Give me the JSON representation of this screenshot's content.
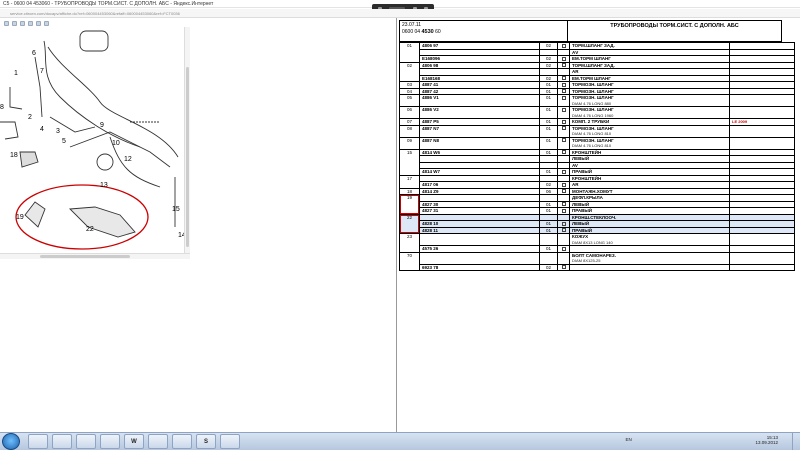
{
  "window": {
    "title": "C5 - 0600 04 453060 - ТРУБОПРОВОДЫ ТОРМ.СИСТ. С ДОПОЛН. АБС - Яндекс.Интернет",
    "url": "service.citroen.com/docapv/affiche.do?ref=060004453060&refaff=060004453060&ref=FCT0036"
  },
  "diagram": {
    "callouts": [
      "6",
      "7",
      "1",
      "8",
      "2",
      "4",
      "3",
      "5",
      "9",
      "10",
      "18",
      "12",
      "13",
      "15",
      "19",
      "22",
      "14"
    ]
  },
  "header": {
    "date": "23.07.11",
    "part_prefix": "0600 04",
    "part_bold": "4530",
    "part_suffix": "60",
    "title": "ТРУБОПРОВОДЫ ТОРМ.СИСТ. С ДОПОЛН. АБС"
  },
  "rows": [
    {
      "num": "01",
      "lines": [
        {
          "ref": "4806 97",
          "qty": "02",
          "desc": "ТОРМ.ШЛАНГ ЗАД.",
          "chk": true
        },
        {
          "ref": "",
          "qty": "",
          "desc": "АV"
        },
        {
          "ref": "E168096",
          "qty": "02",
          "desc": "ЕМ.ТОРМ ШЛАНГ",
          "chk": true
        }
      ]
    },
    {
      "num": "02",
      "lines": [
        {
          "ref": "4806 98",
          "qty": "02",
          "desc": "ТОРМ.ШЛАНГ ЗАД.",
          "chk": true
        },
        {
          "ref": "",
          "qty": "",
          "desc": "AR"
        },
        {
          "ref": "E168168",
          "qty": "02",
          "desc": "ЕМ.ТОРМ ШЛАНГ",
          "chk": true
        }
      ]
    },
    {
      "num": "03",
      "lines": [
        {
          "ref": "4887 41",
          "qty": "01",
          "desc": "ТОРМОЗН. ШЛАНГ",
          "chk": true
        }
      ]
    },
    {
      "num": "04",
      "lines": [
        {
          "ref": "4887 42",
          "qty": "01",
          "desc": "ТОРМОЗН. ШЛАНГ",
          "chk": true
        }
      ]
    },
    {
      "num": "05",
      "lines": [
        {
          "ref": "4886 V1",
          "qty": "01",
          "desc": "ТОРМОЗН. ШЛАНГ",
          "sub": "DIAM 4.76 LONG 880",
          "chk": true
        }
      ]
    },
    {
      "num": "06",
      "lines": [
        {
          "ref": "4886 V2",
          "qty": "01",
          "desc": "ТОРМОЗН. ШЛАНГ",
          "sub": "DIAM 4.76 LONG 1960",
          "chk": true
        }
      ]
    },
    {
      "num": "07",
      "lines": [
        {
          "ref": "4887 P5",
          "qty": "01",
          "desc": "КОМП. 2 ТРУБКИ",
          "note": "LE 2009",
          "chk": true
        }
      ]
    },
    {
      "num": "08",
      "lines": [
        {
          "ref": "4887 N7",
          "qty": "01",
          "desc": "ТОРМОЗН. ШЛАНГ",
          "sub": "DIAM 4.76 LONG 810",
          "chk": true
        }
      ]
    },
    {
      "num": "09",
      "lines": [
        {
          "ref": "4887 N8",
          "qty": "01",
          "desc": "ТОРМОЗН. ШЛАНГ",
          "sub": "DIAM 4.76 LONG 810",
          "chk": true
        }
      ]
    },
    {
      "num": "15",
      "lines": [
        {
          "ref": "4814 W6",
          "qty": "01",
          "desc": "КРОНШТЕЙН",
          "chk": true
        },
        {
          "ref": "",
          "qty": "",
          "desc": "ЛЕВЫЙ"
        },
        {
          "ref": "",
          "qty": "",
          "desc": "AV"
        },
        {
          "ref": "4814 W7",
          "qty": "01",
          "desc": "ПРАВЫЙ",
          "chk": true
        }
      ]
    },
    {
      "num": "17",
      "lines": [
        {
          "ref": "",
          "qty": "",
          "desc": "КРОНШТЕЙН"
        },
        {
          "ref": "4817 06",
          "qty": "02",
          "desc": "AR",
          "chk": true
        }
      ]
    },
    {
      "num": "18",
      "lines": [
        {
          "ref": "4814 Z9",
          "qty": "06",
          "desc": "МОНТАЖН.ХОМУТ",
          "chk": true
        }
      ]
    },
    {
      "num": "19",
      "circled": true,
      "lines": [
        {
          "ref": "",
          "qty": "",
          "desc": "ДЕФЛ.КРЫЛА"
        },
        {
          "ref": "4827 30",
          "qty": "01",
          "desc": "ЛЕВЫЙ",
          "chk": true
        },
        {
          "ref": "4827 31",
          "qty": "01",
          "desc": "ПРАВЫЙ",
          "chk": true
        }
      ]
    },
    {
      "num": "22",
      "circled": true,
      "selected": true,
      "lines": [
        {
          "ref": "",
          "qty": "",
          "desc": "КРОНШ.СТЕКЛООЧ."
        },
        {
          "ref": "4828 10",
          "qty": "01",
          "desc": "ЛЕВЫЙ",
          "chk": true
        },
        {
          "ref": "4828 11",
          "qty": "01",
          "desc": "ПРАВЫЙ",
          "chk": true
        }
      ]
    },
    {
      "num": "23",
      "lines": [
        {
          "ref": "",
          "qty": "",
          "desc": "КОЖУХ",
          "sub": "DIAM 8X13 LONG 140"
        },
        {
          "ref": "4575 26",
          "qty": "01",
          "desc": "",
          "chk": true
        }
      ]
    },
    {
      "num": "70",
      "lines": [
        {
          "ref": "",
          "qty": "",
          "desc": "БОЛТ САМОНАРЕЗ.",
          "sub": "DIAM 8X125-25"
        },
        {
          "ref": "6923 78",
          "qty": "02",
          "desc": "",
          "chk": true
        }
      ]
    }
  ],
  "taskbar": {
    "apps": [
      "",
      "",
      "",
      "",
      "W",
      "",
      "",
      "S",
      ""
    ],
    "lang": "EN",
    "time": "15:13",
    "date": "13.09.2012"
  },
  "colors": {
    "circle_red": "#cc0000",
    "selected_row": "#dde7f5"
  }
}
